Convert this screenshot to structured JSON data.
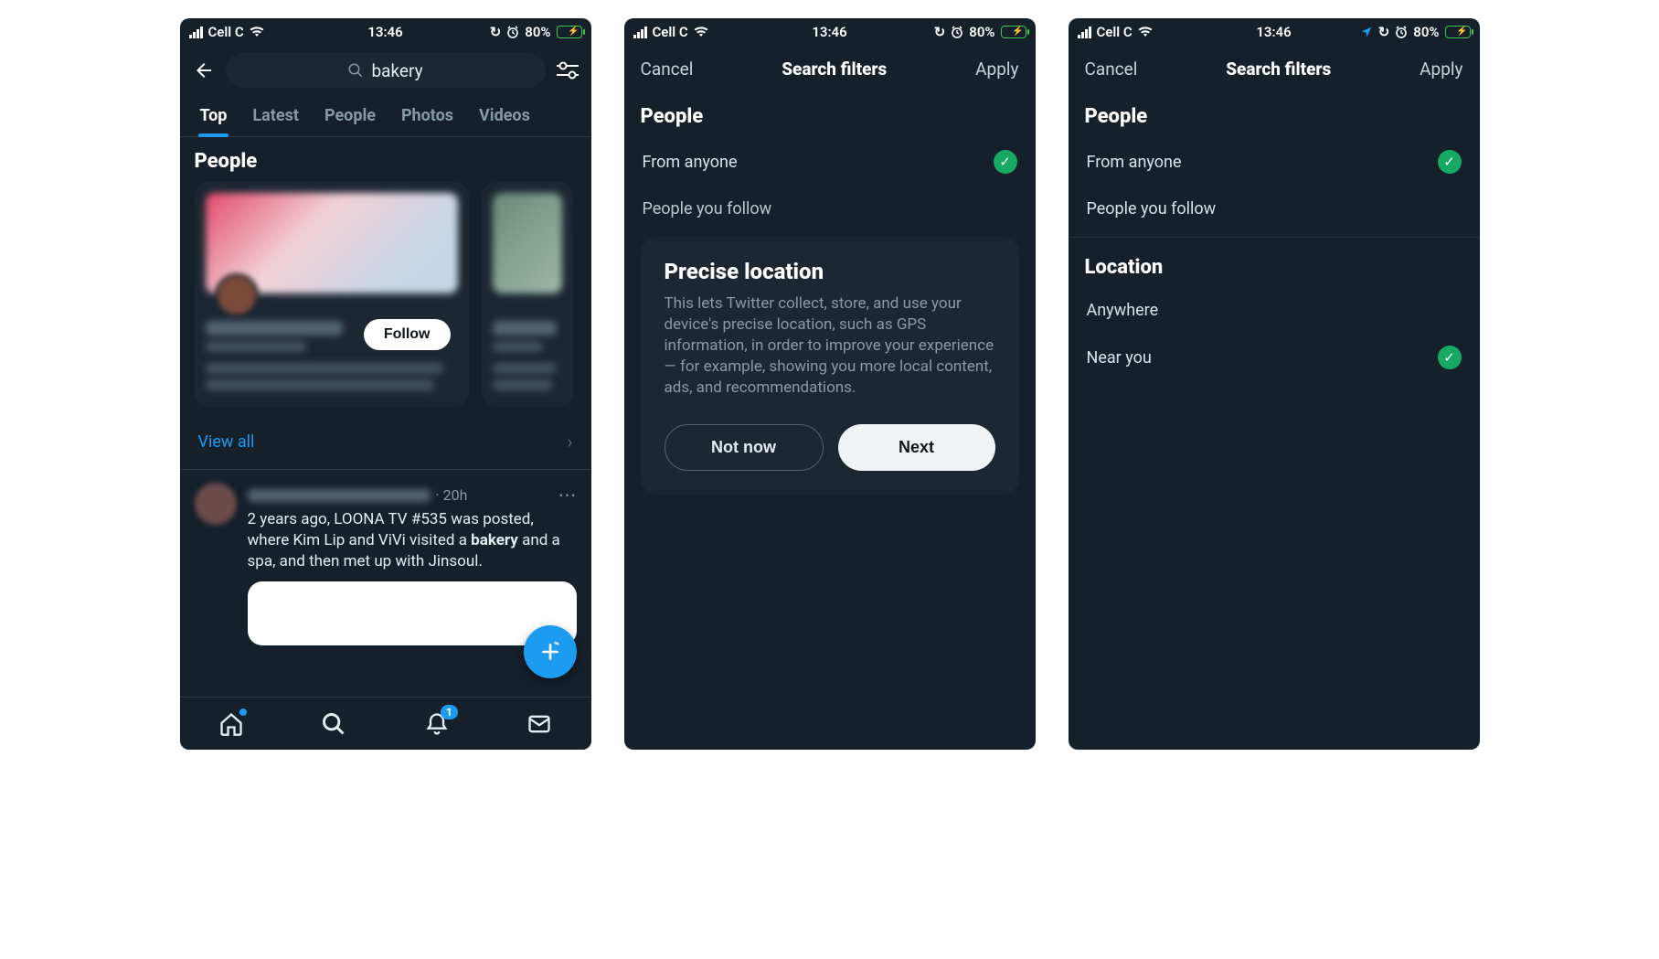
{
  "status": {
    "carrier": "Cell C",
    "time": "13:46",
    "battery_percent": "80%"
  },
  "phone1": {
    "search_query": "bakery",
    "tabs": [
      "Top",
      "Latest",
      "People",
      "Photos",
      "Videos"
    ],
    "active_tab": 0,
    "people_heading": "People",
    "follow_label": "Follow",
    "view_all_label": "View all",
    "tweet": {
      "time": "20h",
      "text_pre": "2 years ago, LOONA TV #535 was posted, where Kim Lip and ViVi visited a ",
      "text_bold": "bakery",
      "text_post": " and a spa, and then met up with Jinsoul."
    },
    "nav_badge": "1"
  },
  "filters": {
    "cancel": "Cancel",
    "title": "Search filters",
    "apply": "Apply",
    "people_section": "People",
    "from_anyone": "From anyone",
    "people_you_follow": "People you follow",
    "location_section": "Location",
    "anywhere": "Anywhere",
    "near_you": "Near you"
  },
  "modal": {
    "title": "Precise location",
    "body": "This lets Twitter collect, store, and use your device's precise location, such as GPS information, in order to improve your experience — for example, showing you more local content, ads, and recommendations.",
    "not_now": "Not now",
    "next": "Next"
  }
}
